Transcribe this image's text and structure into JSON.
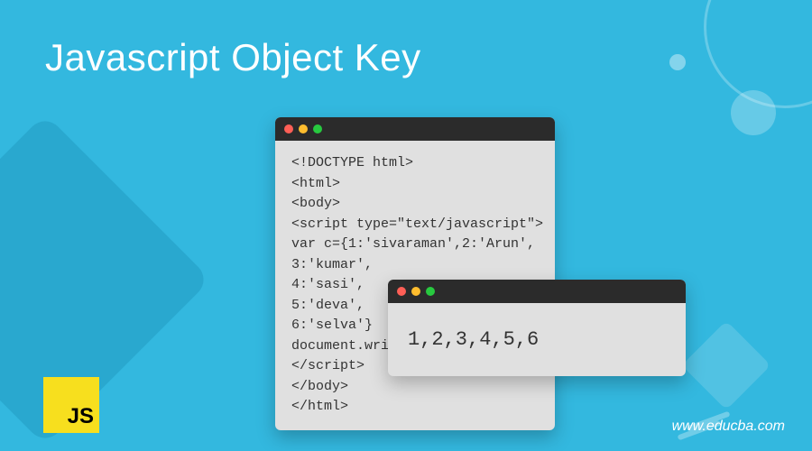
{
  "title": "Javascript Object Key",
  "code_window": {
    "lines": "<!DOCTYPE html>\n<html>\n<body>\n<script type=\"text/javascript\">\nvar c={1:'sivaraman',2:'Arun',\n3:'kumar',\n4:'sasi',\n5:'deva',\n6:'selva'}\ndocument.write(\n</script>\n</body>\n</html>"
  },
  "output_window": {
    "content": "1,2,3,4,5,6"
  },
  "logo": {
    "text": "JS"
  },
  "footer": {
    "url": "www.educba.com"
  }
}
